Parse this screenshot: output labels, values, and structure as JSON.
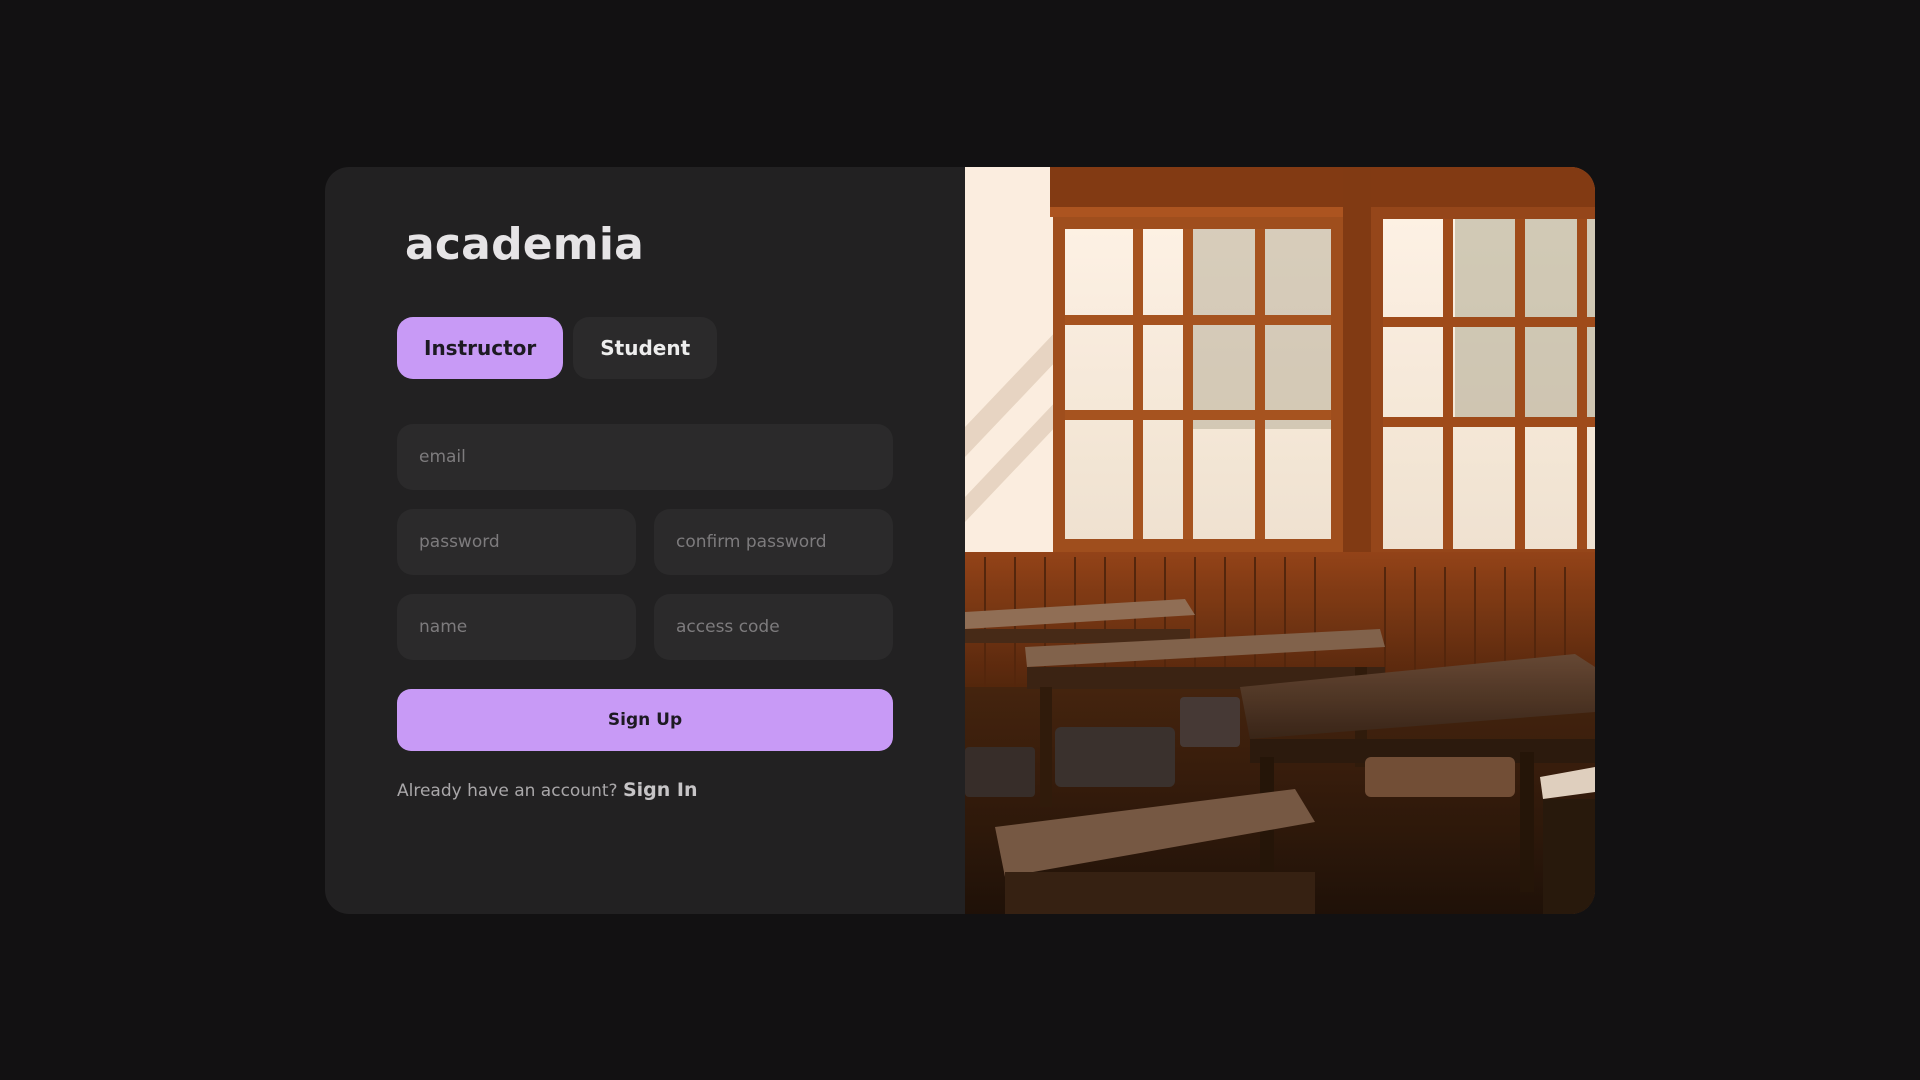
{
  "brand": {
    "name": "academia"
  },
  "role_toggle": {
    "options": [
      {
        "label": "Instructor",
        "selected": true
      },
      {
        "label": "Student",
        "selected": false
      }
    ]
  },
  "form": {
    "email": {
      "placeholder": "email",
      "value": ""
    },
    "password": {
      "placeholder": "password",
      "value": ""
    },
    "confirm_password": {
      "placeholder": "confirm password",
      "value": ""
    },
    "name": {
      "placeholder": "name",
      "value": ""
    },
    "access_code": {
      "placeholder": "access code",
      "value": ""
    },
    "submit_label": "Sign Up"
  },
  "footer": {
    "prompt": "Already have an account?",
    "signin_label": "Sign In"
  },
  "colors": {
    "page_background": "#121112",
    "card_background": "#222122",
    "field_background": "#2b2a2b",
    "accent": "#c89af6"
  },
  "image": {
    "subject": "classroom-photo"
  }
}
